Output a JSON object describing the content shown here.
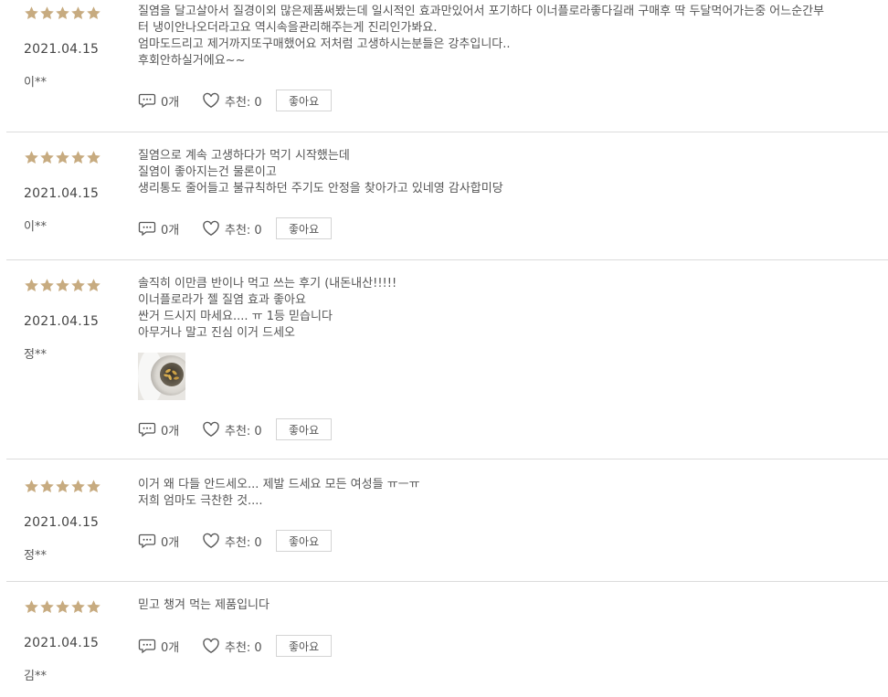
{
  "colors": {
    "star": "#c7ab80",
    "divider": "#dcdcdc",
    "text": "#555555"
  },
  "reviews": [
    {
      "rating": 5,
      "date": "2021.04.15",
      "author": "이**",
      "lines": [
        "질염을 달고살아서 질경이외 많은제품써봤는데 일시적인 효과만있어서 포기하다 이너플로라좋다길래 구매후 딱 두달먹어가는중 어느순간부",
        "터 냉이안나오더라고요 역시속을관리해주는게 진리인가봐요.",
        "엄마도드리고 제거까지또구매했어요 저처럼 고생하시는분들은 강추입니다..",
        "후회안하실거에요~~"
      ],
      "comments": "0개",
      "recommend": "추천: 0",
      "like_label": "좋아요"
    },
    {
      "rating": 5,
      "date": "2021.04.15",
      "author": "이**",
      "lines": [
        "질염으로 계속 고생하다가 먹기 시작했는데",
        "질염이 좋아지는건 물론이고",
        "생리통도 줄어들고 불규칙하던 주기도 안정을 찾아가고 있네영 감사합미당"
      ],
      "comments": "0개",
      "recommend": "추천: 0",
      "like_label": "좋아요"
    },
    {
      "rating": 5,
      "date": "2021.04.15",
      "author": "정**",
      "lines": [
        "솔직히 이만큼 반이나 먹고 쓰는 후기 (내돈내산!!!!!",
        "이너플로라가 젤 질염 효과 좋아요",
        "싼거 드시지 마세요.... ㅠ 1등 믿습니다",
        "아무거나 말고 진심 이거 드세오"
      ],
      "has_photo": true,
      "comments": "0개",
      "recommend": "추천: 0",
      "like_label": "좋아요"
    },
    {
      "rating": 5,
      "date": "2021.04.15",
      "author": "정**",
      "lines": [
        "이거 왜 다들 안드세오... 제발 드세요 모든 여성들 ㅠㅡㅠ",
        "저희 엄마도 극찬한 것...."
      ],
      "comments": "0개",
      "recommend": "추천: 0",
      "like_label": "좋아요"
    },
    {
      "rating": 5,
      "date": "2021.04.15",
      "author": "김**",
      "lines": [
        "믿고 챙겨 먹는 제품입니다"
      ],
      "comments": "0개",
      "recommend": "추천: 0",
      "like_label": "좋아요"
    }
  ]
}
